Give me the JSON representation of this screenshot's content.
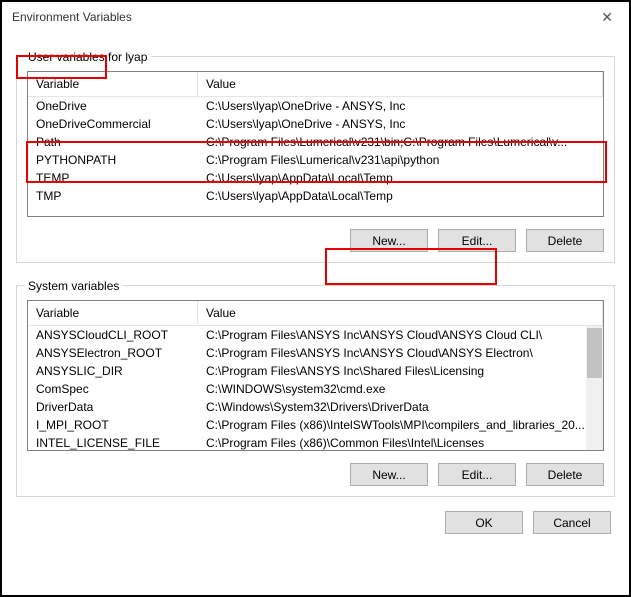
{
  "window": {
    "title": "Environment Variables"
  },
  "user_section": {
    "label": "User variables for lyap",
    "headers": {
      "variable": "Variable",
      "value": "Value"
    },
    "rows": [
      {
        "variable": "OneDrive",
        "value": "C:\\Users\\lyap\\OneDrive - ANSYS, Inc"
      },
      {
        "variable": "OneDriveCommercial",
        "value": "C:\\Users\\lyap\\OneDrive - ANSYS, Inc"
      },
      {
        "variable": "Path",
        "value": "C:\\Program Files\\Lumerical\\v231\\bin;C:\\Program Files\\Lumerical\\v..."
      },
      {
        "variable": "PYTHONPATH",
        "value": "C:\\Program Files\\Lumerical\\v231\\api\\python"
      },
      {
        "variable": "TEMP",
        "value": "C:\\Users\\lyap\\AppData\\Local\\Temp"
      },
      {
        "variable": "TMP",
        "value": "C:\\Users\\lyap\\AppData\\Local\\Temp"
      }
    ],
    "buttons": {
      "new": "New...",
      "edit": "Edit...",
      "delete": "Delete"
    }
  },
  "system_section": {
    "label": "System variables",
    "headers": {
      "variable": "Variable",
      "value": "Value"
    },
    "rows": [
      {
        "variable": "ANSYSCloudCLI_ROOT",
        "value": "C:\\Program Files\\ANSYS Inc\\ANSYS Cloud\\ANSYS Cloud CLI\\"
      },
      {
        "variable": "ANSYSElectron_ROOT",
        "value": "C:\\Program Files\\ANSYS Inc\\ANSYS Cloud\\ANSYS Electron\\"
      },
      {
        "variable": "ANSYSLIC_DIR",
        "value": "C:\\Program Files\\ANSYS Inc\\Shared Files\\Licensing"
      },
      {
        "variable": "ComSpec",
        "value": "C:\\WINDOWS\\system32\\cmd.exe"
      },
      {
        "variable": "DriverData",
        "value": "C:\\Windows\\System32\\Drivers\\DriverData"
      },
      {
        "variable": "I_MPI_ROOT",
        "value": "C:\\Program Files (x86)\\IntelSWTools\\MPI\\compilers_and_libraries_20..."
      },
      {
        "variable": "INTEL_LICENSE_FILE",
        "value": "C:\\Program Files (x86)\\Common Files\\Intel\\Licenses"
      }
    ],
    "buttons": {
      "new": "New...",
      "edit": "Edit...",
      "delete": "Delete"
    }
  },
  "dialog_buttons": {
    "ok": "OK",
    "cancel": "Cancel"
  },
  "highlights": {
    "color": "#e60000"
  }
}
